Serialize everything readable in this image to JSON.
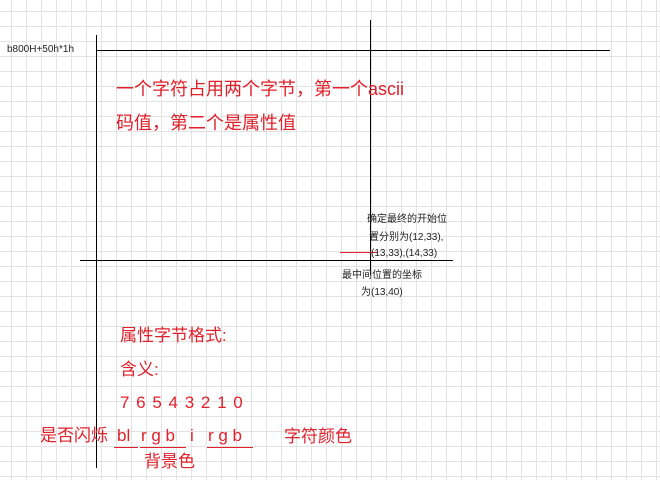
{
  "labels": {
    "memory_address": "b800H+50h*1h",
    "desc_line1": "一个字符占用两个字节，第一个ascii",
    "desc_line2": "码值，第二个是属性值",
    "start_pos_line1": "确定最终的开始位",
    "start_pos_line2": "置分别为(12,33),",
    "start_pos_line3": "(13,33),(14,33)",
    "center_line1": "最中间位置的坐标",
    "center_line2": "为(13,40)",
    "attr_format": "属性字节格式:",
    "meaning": "含义:",
    "bit_numbers": "7 6 5 4 3 2 1 0",
    "blink": "是否闪烁",
    "bits_bl": "bl",
    "bits_bg": "r g b",
    "bits_i": "i",
    "bits_fg": "r g b",
    "bg_color": "背景色",
    "fg_color": "字符颜色"
  },
  "colors": {
    "annotation": "#e0212b",
    "grid": "#e3e3e3",
    "axis": "#000000"
  }
}
